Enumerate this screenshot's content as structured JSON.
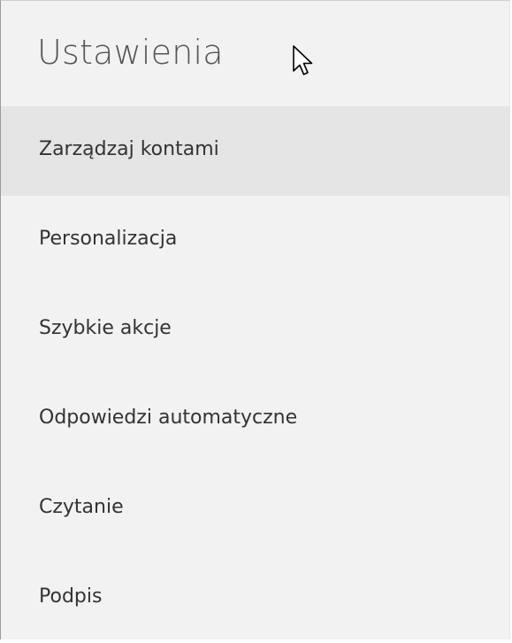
{
  "settings": {
    "title": "Ustawienia",
    "menu": [
      {
        "label": "Zarządzaj kontami",
        "hovered": true
      },
      {
        "label": "Personalizacja",
        "hovered": false
      },
      {
        "label": "Szybkie akcje",
        "hovered": false
      },
      {
        "label": "Odpowiedzi automatyczne",
        "hovered": false
      },
      {
        "label": "Czytanie",
        "hovered": false
      },
      {
        "label": "Podpis",
        "hovered": false
      }
    ]
  },
  "colors": {
    "pane_background": "#f2f2f2",
    "hover_background": "#e5e5e5",
    "title_text": "#555555",
    "item_text": "#333333"
  },
  "pointer": {
    "icon": "mouse-pointer-icon"
  }
}
